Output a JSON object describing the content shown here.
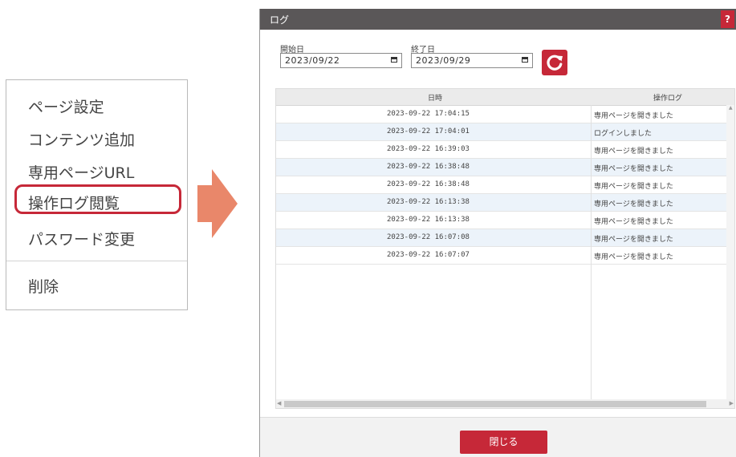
{
  "menu": {
    "items": [
      {
        "label": "ページ設定"
      },
      {
        "label": "コンテンツ追加"
      },
      {
        "label": "専用ページURL"
      },
      {
        "label": "操作ログ閲覧"
      },
      {
        "label": "パスワード変更"
      },
      {
        "label": "削除"
      }
    ],
    "highlighted_index": 3
  },
  "dialog": {
    "title": "ログ",
    "help_label": "?",
    "start_label": "開始日",
    "start_value": "2023/09/22",
    "end_label": "終了日",
    "end_value": "2023/09/29",
    "columns": [
      "日時",
      "操作ログ"
    ],
    "rows": [
      {
        "datetime": "2023-09-22 17:04:15",
        "message": "専用ページを開きました"
      },
      {
        "datetime": "2023-09-22 17:04:01",
        "message": "ログインしました"
      },
      {
        "datetime": "2023-09-22 16:39:03",
        "message": "専用ページを開きました"
      },
      {
        "datetime": "2023-09-22 16:38:48",
        "message": "専用ページを開きました"
      },
      {
        "datetime": "2023-09-22 16:38:48",
        "message": "専用ページを開きました"
      },
      {
        "datetime": "2023-09-22 16:13:38",
        "message": "専用ページを開きました"
      },
      {
        "datetime": "2023-09-22 16:13:38",
        "message": "専用ページを開きました"
      },
      {
        "datetime": "2023-09-22 16:07:08",
        "message": "専用ページを開きました"
      },
      {
        "datetime": "2023-09-22 16:07:07",
        "message": "専用ページを開きました"
      }
    ],
    "close_label": "閉じる"
  },
  "colors": {
    "accent": "#c62838",
    "titlebar": "#5a5758",
    "arrow": "#e9876a",
    "row_alt": "#ecf3fa"
  },
  "icons": {
    "refresh": "refresh-icon",
    "calendar": "calendar-icon",
    "arrow": "arrow-right-icon"
  }
}
